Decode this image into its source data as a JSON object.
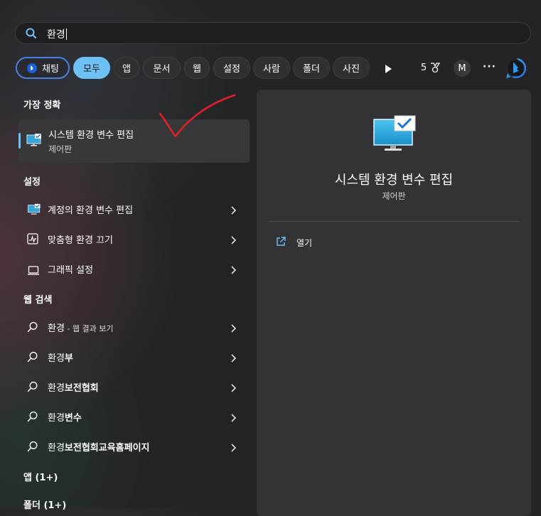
{
  "search": {
    "query": "환경"
  },
  "filters": {
    "chat": "채팅",
    "all": "모두",
    "apps": "앱",
    "documents": "문서",
    "web": "웹",
    "settings": "설정",
    "people": "사람",
    "folders": "폴더",
    "photos": "사진",
    "points": "5",
    "account_initial": "M",
    "more": "···"
  },
  "left": {
    "best_match_header": "가장 정확",
    "best_match": {
      "title": "시스템 환경 변수 편집",
      "subtitle": "제어판"
    },
    "settings_header": "설정",
    "settings_items": [
      "계정의 환경 변수 편집",
      "맞춤형 환경 끄기",
      "그래픽 설정"
    ],
    "web_header": "웹 검색",
    "web_items": [
      {
        "bold": "",
        "plain": "환경",
        "small": " - 웹 결과 보기"
      },
      {
        "plain": "환경",
        "bold": "부"
      },
      {
        "plain": "환경",
        "bold": "보전협회"
      },
      {
        "plain": "환경",
        "bold": "변수"
      },
      {
        "plain": "환경",
        "bold": "보전협회교육홈페이지"
      }
    ],
    "apps_header": "앱 (1+)",
    "folders_header": "폴더 (1+)"
  },
  "preview": {
    "title": "시스템 환경 변수 편집",
    "subtitle": "제어판",
    "open_label": "열기"
  },
  "colors": {
    "accent": "#6ec1f4",
    "annotation": "#e0202a"
  }
}
